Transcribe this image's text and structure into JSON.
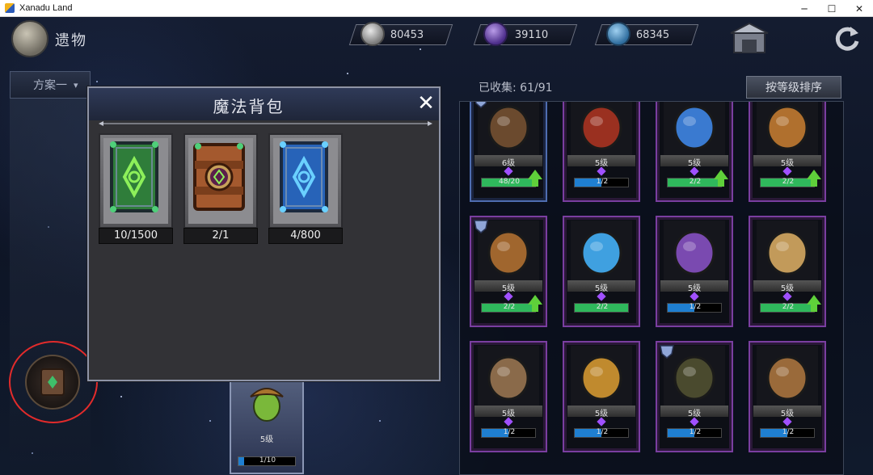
{
  "window": {
    "title": "Xanadu Land",
    "minimize": "─",
    "maximize": "☐",
    "close": "✕"
  },
  "topbar": {
    "page_title": "遗物",
    "currencies": [
      {
        "icon": "silver-coin-icon",
        "value": "80453"
      },
      {
        "icon": "purple-gem-icon",
        "value": "39110"
      },
      {
        "icon": "blue-crystal-icon",
        "value": "68345"
      }
    ]
  },
  "left": {
    "plan_label": "方案一",
    "plan_chevron": "▾"
  },
  "mid_card": {
    "level": "5级",
    "progress": "1/10",
    "progress_ratio": 0.1
  },
  "right_panel": {
    "collected": "已收集: 61/91",
    "sort_button": "按等级排序",
    "cards": [
      {
        "name": "dark-armor-relic",
        "level": "6级",
        "progress": "48/20",
        "ratio": 1.0,
        "bar": "#2fb85c",
        "upgrade": true,
        "frame": "blue",
        "mask": true
      },
      {
        "name": "crystal-ball-relic",
        "level": "5级",
        "progress": "1/2",
        "ratio": 0.5,
        "bar": "#1f7fd1",
        "upgrade": false,
        "frame": "purple",
        "mask": false
      },
      {
        "name": "blue-staff-relic",
        "level": "5级",
        "progress": "2/2",
        "ratio": 1.0,
        "bar": "#2fb85c",
        "upgrade": true,
        "frame": "purple",
        "mask": false
      },
      {
        "name": "claw-gauntlet-relic",
        "level": "5级",
        "progress": "2/2",
        "ratio": 1.0,
        "bar": "#2fb85c",
        "upgrade": true,
        "frame": "purple",
        "mask": false
      },
      {
        "name": "beer-mug-relic",
        "level": "5级",
        "progress": "2/2",
        "ratio": 1.0,
        "bar": "#2fb85c",
        "upgrade": true,
        "frame": "purple",
        "mask": true
      },
      {
        "name": "ice-star-relic",
        "level": "5级",
        "progress": "2/2",
        "ratio": 1.0,
        "bar": "#2fb85c",
        "upgrade": false,
        "frame": "purple",
        "mask": false
      },
      {
        "name": "mushroom-relic",
        "level": "5级",
        "progress": "1/2",
        "ratio": 0.5,
        "bar": "#1f7fd1",
        "upgrade": false,
        "frame": "purple",
        "mask": false
      },
      {
        "name": "scroll-relic",
        "level": "5级",
        "progress": "2/2",
        "ratio": 1.0,
        "bar": "#2fb85c",
        "upgrade": true,
        "frame": "purple",
        "mask": false
      },
      {
        "name": "leather-vest-relic",
        "level": "5级",
        "progress": "1/2",
        "ratio": 0.5,
        "bar": "#1f7fd1",
        "upgrade": false,
        "frame": "purple",
        "mask": false
      },
      {
        "name": "golden-fist-relic",
        "level": "5级",
        "progress": "1/2",
        "ratio": 0.5,
        "bar": "#1f7fd1",
        "upgrade": false,
        "frame": "purple",
        "mask": false
      },
      {
        "name": "rune-ring-relic",
        "level": "5级",
        "progress": "1/2",
        "ratio": 0.5,
        "bar": "#1f7fd1",
        "upgrade": false,
        "frame": "purple",
        "mask": true
      },
      {
        "name": "leather-boot-relic",
        "level": "5级",
        "progress": "1/2",
        "ratio": 0.5,
        "bar": "#1f7fd1",
        "upgrade": false,
        "frame": "purple",
        "mask": false
      }
    ]
  },
  "modal": {
    "title": "魔法背包",
    "close_label": "✕",
    "items": [
      {
        "name": "green-spellbook",
        "count": "10/1500"
      },
      {
        "name": "leather-spellbook",
        "count": "2/1"
      },
      {
        "name": "blue-spellbook",
        "count": "4/800"
      }
    ]
  }
}
